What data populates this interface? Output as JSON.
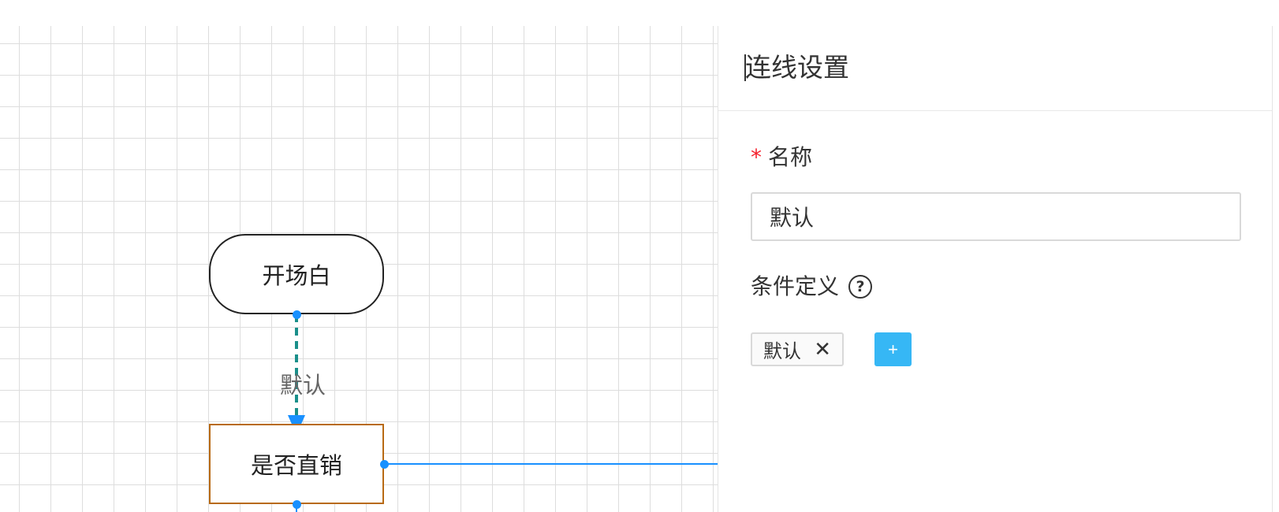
{
  "flow": {
    "start_node_label": "开场白",
    "decision_node_label": "是否直销",
    "edge_label": "默认"
  },
  "panel": {
    "title": "连线设置",
    "name_field": {
      "required_mark": "*",
      "label": "名称",
      "value": "默认"
    },
    "condition_field": {
      "label": "条件定义",
      "help_icon_glyph": "?",
      "tags": [
        {
          "label": "默认",
          "close_glyph": "✕"
        }
      ],
      "add_button_label": "+"
    }
  },
  "colors": {
    "accent_blue": "#1890ff",
    "edge_dashed": "#1a8f8a",
    "add_button": "#36b7f5",
    "decision_border": "#b86a14",
    "required": "#f5222d"
  }
}
